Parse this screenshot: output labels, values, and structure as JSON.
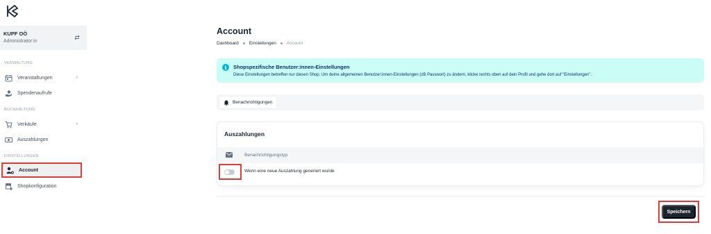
{
  "org": {
    "name": "KUPF OÖ",
    "role": "Administrator:in"
  },
  "sidebar": {
    "sections": [
      {
        "label": "VERWALTUNG",
        "items": [
          {
            "label": "Veranstaltungen",
            "icon": "calendar-list-icon",
            "has_children": true
          },
          {
            "label": "Spendenaufrufe",
            "icon": "donation-hand-icon"
          }
        ]
      },
      {
        "label": "BUCHHALTUNG",
        "items": [
          {
            "label": "Verkäufe",
            "icon": "cart-icon",
            "has_children": true
          },
          {
            "label": "Auszahlungen",
            "icon": "money-icon"
          }
        ]
      },
      {
        "label": "EINSTELLUNGEN",
        "items": [
          {
            "label": "Account",
            "icon": "user-settings-icon",
            "active": true
          },
          {
            "label": "Shopkonfiguration",
            "icon": "shop-settings-icon"
          }
        ]
      }
    ],
    "chevron": "›"
  },
  "page": {
    "title": "Account"
  },
  "breadcrumb": [
    "Dashboard",
    "Einstellungen",
    "Account"
  ],
  "info": {
    "icon": "i",
    "title": "Shopspezifische Benutzer:innen-Einstellungen",
    "text": "Diese Einstellungen betreffen nur diesen Shop. Um deine allgemeinen Benutzer:innen-Einstellungen (zB Passwort) zu ändern, klicke rechts oben auf dein Profil und gehe dort auf \"Einstellungen\"."
  },
  "tabs": [
    {
      "label": "Benachrichtigungen",
      "icon": "bell-icon",
      "selected": true
    }
  ],
  "payouts_card": {
    "title": "Auszahlungen",
    "column_header": "Benachrichtigungstyp",
    "rows": [
      {
        "label": "Wenn eine neue Auszahlung generiert wurde",
        "enabled": false
      }
    ]
  },
  "actions": {
    "save_label": "Speichern"
  },
  "colors": {
    "accent_dark": "#1c252e",
    "info_bg": "#cafdf5",
    "info_icon": "#00b8d9",
    "highlight": "#e53935"
  }
}
